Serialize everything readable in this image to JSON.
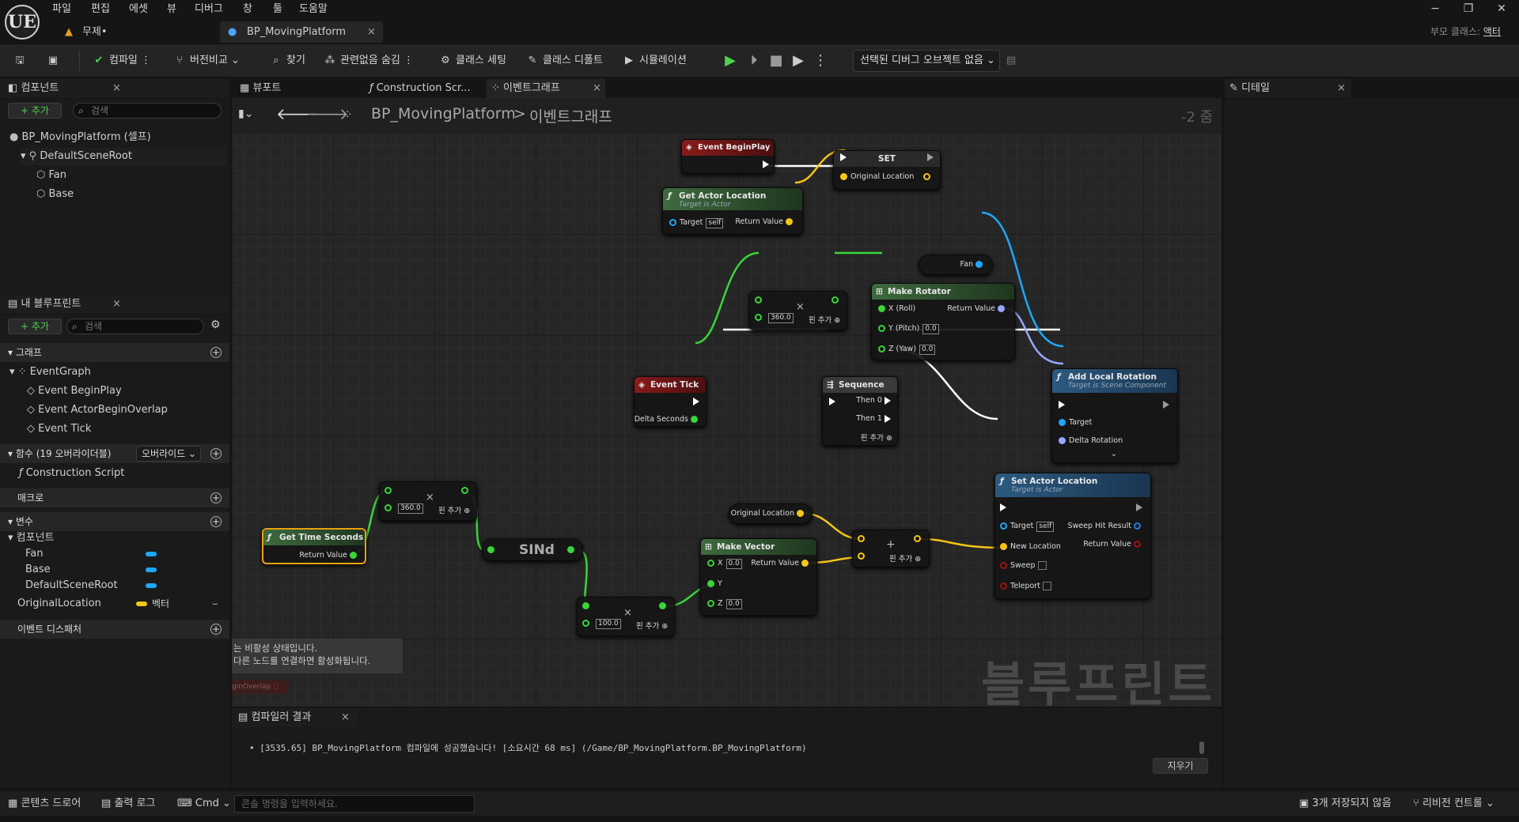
{
  "app": {
    "logo": "UE"
  },
  "menu": [
    "파일",
    "편집",
    "에셋",
    "뷰",
    "디버그",
    "창",
    "툴",
    "도움말"
  ],
  "tabs": {
    "level": "무제•",
    "blueprint": "BP_MovingPlatform"
  },
  "parent_class": {
    "label": "부모 클래스:",
    "value": "액터"
  },
  "toolbar": {
    "compile": "컴파일",
    "diff": "버전비교",
    "find": "찾기",
    "hide_unrelated": "관련없음 숨김",
    "class_settings": "클래스 세팅",
    "class_defaults": "클래스 디폴트",
    "simulation": "시뮬레이션",
    "debug_object": "선택된 디버그 오브젝트 없음"
  },
  "components": {
    "title": "컴포넌트",
    "add": "+ 추가",
    "search_placeholder": "검색",
    "root": "BP_MovingPlatform (셀프)",
    "items": [
      "DefaultSceneRoot",
      "Fan",
      "Base"
    ]
  },
  "my_blueprint": {
    "title": "내 블루프린트",
    "add": "+ 추가",
    "search_placeholder": "검색",
    "graph_cat": "그래프",
    "event_graph": "EventGraph",
    "events": [
      "Event BeginPlay",
      "Event ActorBeginOverlap",
      "Event Tick"
    ],
    "functions_cat": "함수 (19 오버라이더블)",
    "override": "오버라이드",
    "construction": "Construction Script",
    "macros_cat": "매크로",
    "variables_cat": "변수",
    "components_cat": "컴포넌트",
    "var_components": [
      "Fan",
      "Base",
      "DefaultSceneRoot"
    ],
    "orig_loc": "OriginalLocation",
    "orig_type": "벡터",
    "dispatchers_cat": "이벤트 디스패처"
  },
  "graph_tabs": [
    "뷰포트",
    "Construction Scr...",
    "이벤트그래프"
  ],
  "breadcrumb": {
    "root": "BP_MovingPlatform",
    "sep": ">",
    "current": "이벤트그래프",
    "zoom": "-2 줌"
  },
  "details": {
    "title": "디테일"
  },
  "nodes": {
    "begin_play": "Event BeginPlay",
    "set": "SET",
    "original_location": "Original Location",
    "get_actor_location": "Get Actor Location",
    "target_is_actor": "Target is Actor",
    "target": "Target",
    "self": "self",
    "return_value": "Return Value",
    "fan": "Fan",
    "make_rotator": "Make Rotator",
    "x_roll": "X (Roll)",
    "y_pitch": "Y (Pitch)",
    "z_yaw": "Z (Yaw)",
    "zero": "0.0",
    "mult1_val": "360.0",
    "add_pin": "핀 추가",
    "event_tick": "Event Tick",
    "delta_seconds": "Delta Seconds",
    "sequence": "Sequence",
    "then0": "Then 0",
    "then1": "Then 1",
    "add_local_rotation": "Add Local Rotation",
    "target_scene": "Target is Scene Component",
    "delta_rotation": "Delta Rotation",
    "set_actor_location": "Set Actor Location",
    "sweep_hit": "Sweep Hit Result",
    "new_location": "New Location",
    "sweep": "Sweep",
    "teleport": "Teleport",
    "get_time_seconds": "Get Time Seconds",
    "mult2_val": "360.0",
    "sind": "SINd",
    "mult3_val": "100.0",
    "make_vector": "Make Vector",
    "x": "X",
    "y": "Y",
    "z": "Z",
    "disabled_note1": "는 비활성 상태입니다.",
    "disabled_note2": "다른 노드를 연결하면 활성화됩니다.",
    "overlap_node": "ginOverlap"
  },
  "watermark": "블루프린트",
  "compiler": {
    "title": "컴파일러 결과",
    "message": "[3535.65] BP_MovingPlatform 컴파일에 성공했습니다! [소요시간 68 ms] (/Game/BP_MovingPlatform.BP_MovingPlatform)",
    "clear": "지우기"
  },
  "status": {
    "content_drawer": "콘텐츠 드로어",
    "output_log": "출력 로그",
    "cmd": "Cmd",
    "console_placeholder": "콘솔 명령을 입력하세요.",
    "unsaved": "3개 저장되지 않음",
    "revision": "리비전 컨트롤"
  },
  "colors": {
    "exec": "#ffffff",
    "float": "#39d639",
    "vector": "#f5c518",
    "object": "#1ea7ff",
    "rotator": "#9aa6ff",
    "event_header": "#8a1a1a",
    "pure_header": "#3e6b3e",
    "func_header": "#2c5a80"
  }
}
